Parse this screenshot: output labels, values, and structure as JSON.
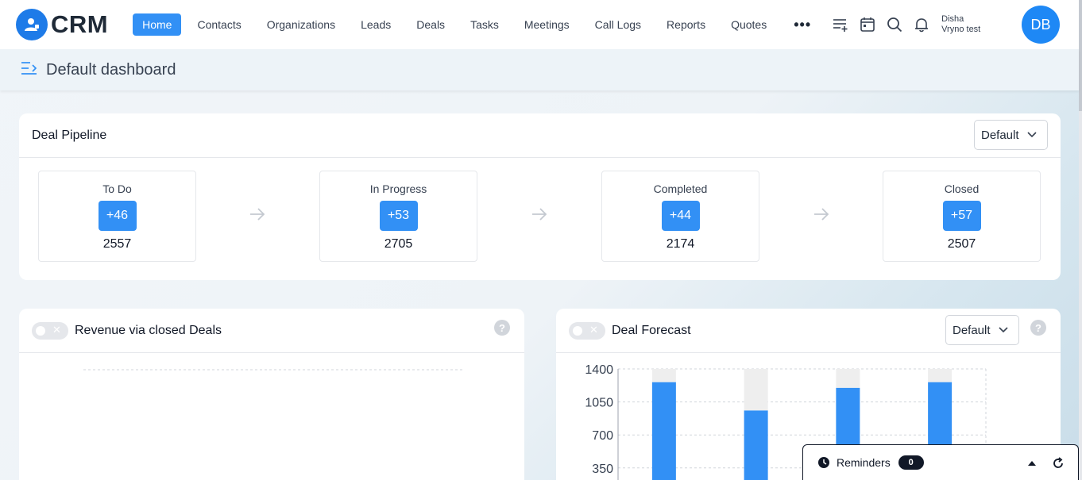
{
  "app": {
    "logo_text": "CRM"
  },
  "nav": {
    "items": [
      {
        "label": "Home",
        "active": true
      },
      {
        "label": "Contacts"
      },
      {
        "label": "Organizations"
      },
      {
        "label": "Leads"
      },
      {
        "label": "Deals"
      },
      {
        "label": "Tasks"
      },
      {
        "label": "Meetings"
      },
      {
        "label": "Call Logs"
      },
      {
        "label": "Reports"
      },
      {
        "label": "Quotes"
      }
    ],
    "more_label": "•••",
    "icons": [
      "add-list-icon",
      "calendar-icon",
      "search-icon",
      "bell-icon"
    ]
  },
  "user": {
    "first_line": "Disha",
    "second_line": "Vryno test",
    "initials": "DB"
  },
  "subheader": {
    "title": "Default dashboard"
  },
  "deal_pipeline": {
    "title": "Deal Pipeline",
    "dropdown": "Default",
    "stages": [
      {
        "label": "To Do",
        "badge": "+46",
        "count": "2557"
      },
      {
        "label": "In Progress",
        "badge": "+53",
        "count": "2705"
      },
      {
        "label": "Completed",
        "badge": "+44",
        "count": "2174"
      },
      {
        "label": "Closed",
        "badge": "+57",
        "count": "2507"
      }
    ]
  },
  "revenue_card": {
    "title": "Revenue via closed Deals",
    "help": "?"
  },
  "forecast_card": {
    "title": "Deal Forecast",
    "dropdown": "Default",
    "help": "?"
  },
  "chart_data": {
    "type": "bar",
    "title": "",
    "ylim": [
      0,
      1400
    ],
    "yticks": [
      "1400",
      "1050",
      "700",
      "350"
    ],
    "series": [
      {
        "values": [
          1260,
          960,
          1200,
          1260
        ],
        "color": "#3290f5"
      },
      {
        "values": [
          140,
          440,
          200,
          140
        ],
        "color": "#eeeeee"
      }
    ],
    "stacked": true,
    "grid": true
  },
  "reminders": {
    "label": "Reminders",
    "count": "0"
  },
  "colors": {
    "accent": "#3290f5",
    "avatar": "#1e88f5"
  }
}
